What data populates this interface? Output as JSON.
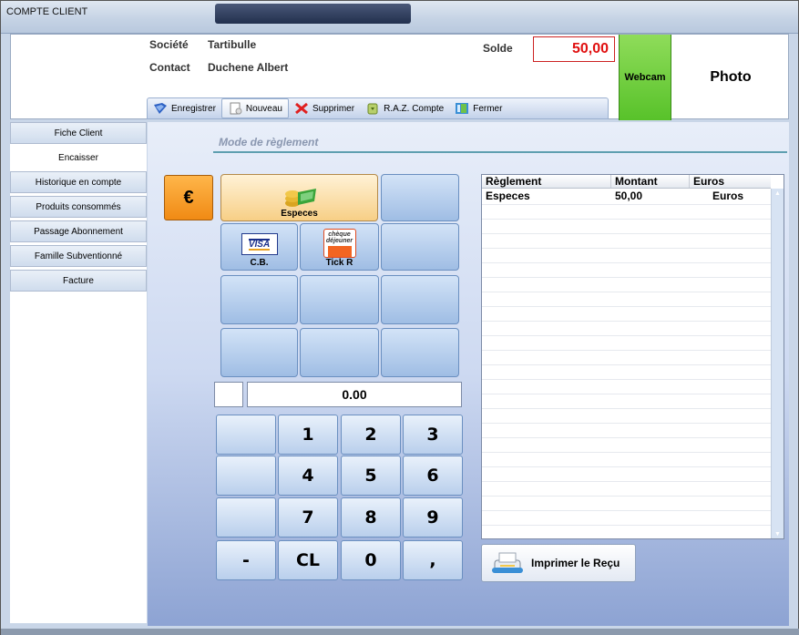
{
  "window": {
    "title": "COMPTE CLIENT"
  },
  "header": {
    "societe_label": "Société",
    "societe_value": "Tartibulle",
    "contact_label": "Contact",
    "contact_value": "Duchene Albert",
    "solde_label": "Solde",
    "solde_value": "50,00",
    "webcam_label": "Webcam",
    "photo_label": "Photo"
  },
  "toolbar": {
    "enregistrer": "Enregistrer",
    "nouveau": "Nouveau",
    "supprimer": "Supprimer",
    "raz": "R.A.Z. Compte",
    "fermer": "Fermer"
  },
  "sidebar": {
    "items": [
      {
        "label": "Fiche Client"
      },
      {
        "label": "Encaisser"
      },
      {
        "label": "Historique en compte"
      },
      {
        "label": "Produits consommés"
      },
      {
        "label": "Passage Abonnement"
      },
      {
        "label": "Famille Subventionné"
      },
      {
        "label": "Facture"
      }
    ]
  },
  "main": {
    "section_title": "Mode de règlement",
    "euro_symbol": "€",
    "payments": {
      "especes": "Especes",
      "cb": "C.B.",
      "visa_text": "VISA",
      "tick": "Tick R",
      "cheque_text_1": "chèque",
      "cheque_text_2": "déjeuner"
    },
    "amount": "0.00",
    "keypad": {
      "k1": "1",
      "k2": "2",
      "k3": "3",
      "k4": "4",
      "k5": "5",
      "k6": "6",
      "k7": "7",
      "k8": "8",
      "k9": "9",
      "minus": "-",
      "clear": "CL",
      "k0": "0",
      "comma": ","
    },
    "table": {
      "headers": [
        "Règlement",
        "Montant",
        "Euros"
      ],
      "rows": [
        [
          "Especes",
          "50,00",
          "Euros"
        ]
      ]
    },
    "print_label": "Imprimer le Reçu"
  },
  "colors": {
    "accent_orange": "#f08a14",
    "webcam_green": "#58c22a",
    "solde_red": "#e01010"
  }
}
